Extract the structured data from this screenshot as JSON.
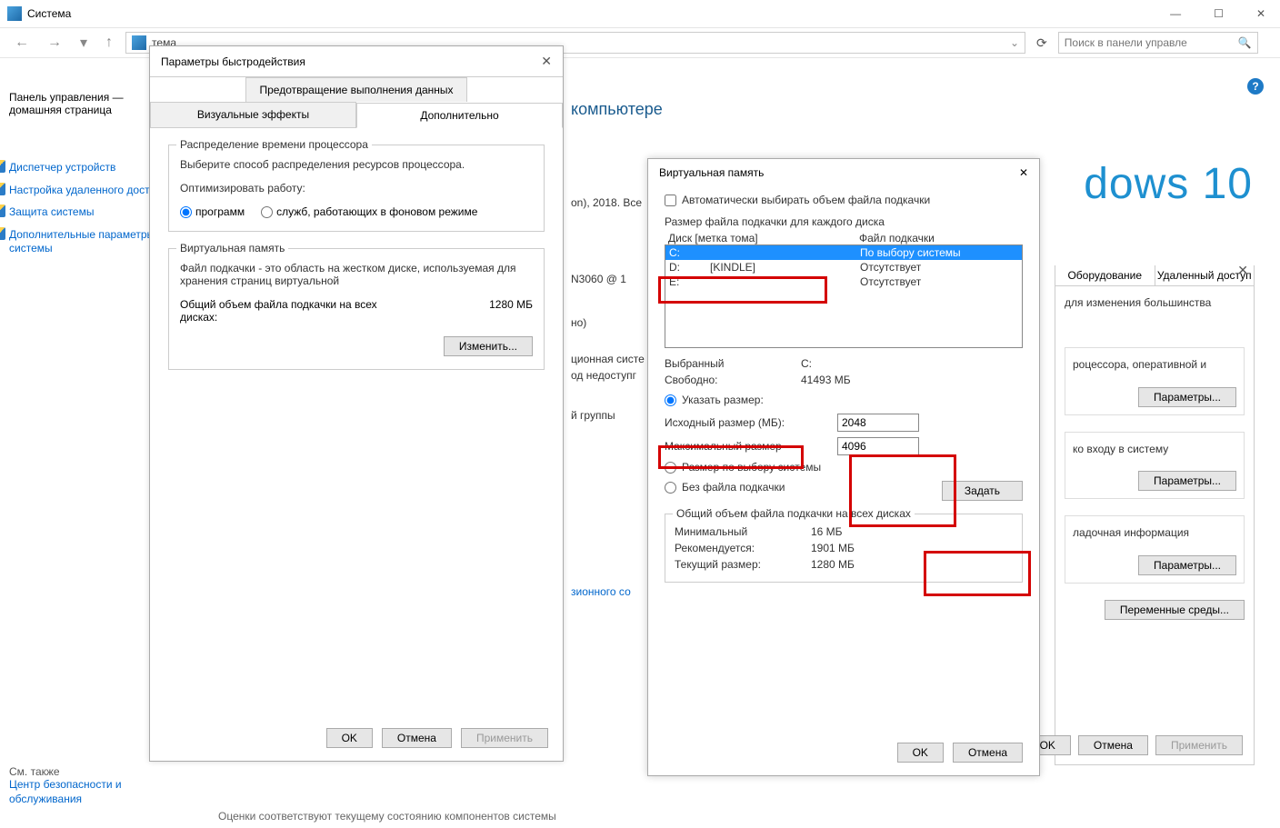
{
  "window": {
    "title": "Система",
    "addressbar_text": "тема",
    "search_placeholder": "Поиск в панели управле"
  },
  "sidebar": {
    "heading1": "Панель управления —",
    "heading2": "домашняя страница",
    "items": [
      "Диспетчер устройств",
      "Настройка удаленного доступа",
      "Защита системы",
      "Дополнительные параметры системы"
    ],
    "see_also": "См. также",
    "security": "Центр безопасности и обслуживания"
  },
  "main": {
    "headline": "компьютере",
    "copyright": "on), 2018. Все",
    "cpu": "N3060 @ 1",
    "bits": "но)",
    "osline": "ционная систе",
    "unavail": "од недоступг",
    "group": "й группы",
    "lic": "зионного со",
    "win10": "dows 10"
  },
  "sysprops": {
    "tab1": "Оборудование",
    "tab2": "Удаленный доступ",
    "para": "для изменения большинства",
    "g1": "роцессора, оперативной и",
    "g2": "ко входу в систему",
    "g3": "ладочная информация",
    "btn_params": "Параметры...",
    "btn_env": "Переменные среды...",
    "ok": "OK",
    "cancel": "Отмена",
    "apply": "Применить"
  },
  "perf": {
    "title": "Параметры быстродействия",
    "tab_dep": "Предотвращение выполнения данных",
    "tab_visual": "Визуальные эффекты",
    "tab_adv": "Дополнительно",
    "cpu_legend": "Распределение времени процессора",
    "cpu_text": "Выберите способ распределения ресурсов процессора.",
    "optimize": "Оптимизировать работу:",
    "opt_programs": "программ",
    "opt_services": "служб, работающих в фоновом режиме",
    "vmem_legend": "Виртуальная память",
    "vmem_text": "Файл подкачки - это область на жестком диске, используемая для хранения страниц виртуальной",
    "vmem_total_label": "Общий объем файла подкачки на всех дисках:",
    "vmem_total_value": "1280 МБ",
    "btn_change": "Изменить...",
    "ok": "OK",
    "cancel": "Отмена",
    "apply": "Применить"
  },
  "vmem": {
    "title": "Виртуальная память",
    "auto": "Автоматически выбирать объем файла подкачки",
    "each_disk": "Размер файла подкачки для каждого диска",
    "hdr_disk": "Диск [метка тома]",
    "hdr_pf": "Файл подкачки",
    "rows": [
      {
        "drive": "C:",
        "label": "",
        "pf": "По выбору системы"
      },
      {
        "drive": "D:",
        "label": "[KINDLE]",
        "pf": "Отсутствует"
      },
      {
        "drive": "E:",
        "label": "",
        "pf": "Отсутствует"
      }
    ],
    "selected_label": "Выбранный",
    "selected_value": "C:",
    "free_label": "Свободно:",
    "free_value": "41493 МБ",
    "custom": "Указать размер:",
    "initial_label": "Исходный размер (МБ):",
    "initial_value": "2048",
    "max_label": "Максимальный размер",
    "max_value": "4096",
    "system_managed": "Размер по выбору системы",
    "no_pf": "Без файла подкачки",
    "btn_set": "Задать",
    "totals_legend": "Общий объем файла подкачки на всех дисках",
    "min_label": "Минимальный",
    "min_value": "16 МБ",
    "rec_label": "Рекомендуется:",
    "rec_value": "1901 МБ",
    "cur_label": "Текущий размер:",
    "cur_value": "1280 МБ",
    "ok": "OK",
    "cancel": "Отмена"
  },
  "footer_text": "Оценки соответствуют текущему состоянию компонентов системы"
}
